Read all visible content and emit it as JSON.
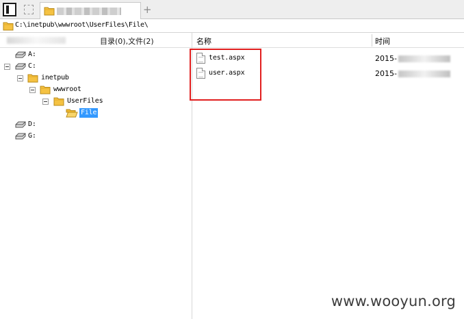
{
  "tabbar": {
    "panel_toggle_icon": "panel-toggle-icon",
    "new_tab_icon": "new-tab-icon",
    "add_tab_label": "+",
    "active_tab_title": ""
  },
  "address": {
    "path": "C:\\inetpub\\wwwroot\\UserFiles\\File\\"
  },
  "left_panel": {
    "summary": "目录(0),文件(2)",
    "tree": [
      {
        "label": "A:",
        "type": "drive",
        "expanded": false
      },
      {
        "label": "C:",
        "type": "drive",
        "expanded": true
      },
      {
        "label": "inetpub",
        "type": "folder",
        "expanded": true
      },
      {
        "label": "wwwroot",
        "type": "folder",
        "expanded": true
      },
      {
        "label": "UserFiles",
        "type": "folder",
        "expanded": true
      },
      {
        "label": "File",
        "type": "folder",
        "selected": true
      },
      {
        "label": "D:",
        "type": "drive",
        "expanded": false
      },
      {
        "label": "G:",
        "type": "drive",
        "expanded": false
      }
    ]
  },
  "file_list": {
    "columns": [
      "名称",
      "时间"
    ],
    "rows": [
      {
        "name": "test.aspx",
        "time": "2015-"
      },
      {
        "name": "user.aspx",
        "time": "2015-"
      }
    ]
  },
  "colors": {
    "highlight_border": "#e11e1e",
    "selection": "#3399ff",
    "folder": "#f5c242"
  },
  "watermark": "www.wooyun.org"
}
